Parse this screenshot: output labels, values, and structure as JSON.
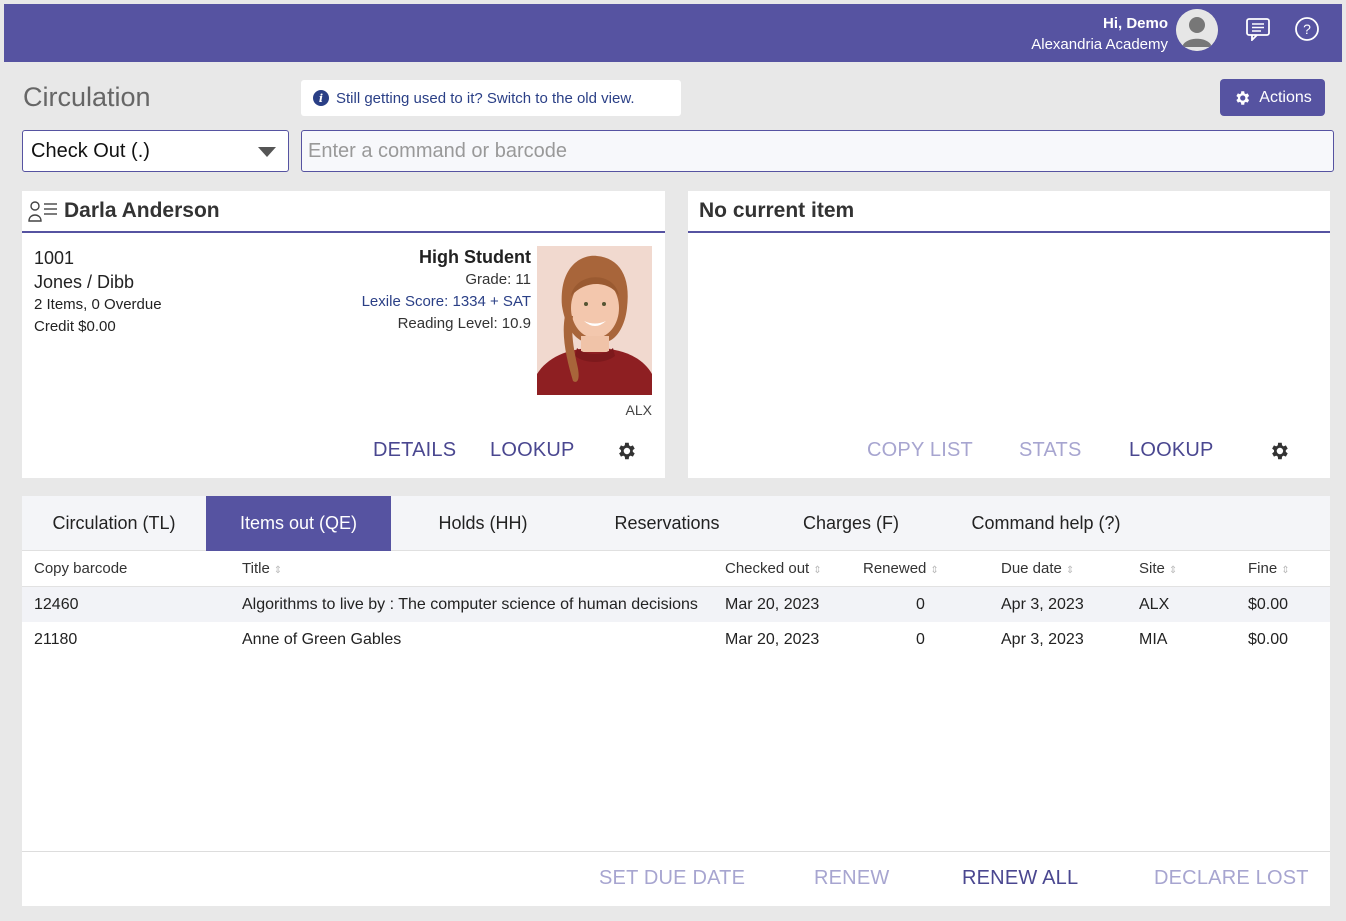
{
  "header": {
    "greeting": "Hi, Demo",
    "school": "Alexandria Academy",
    "icons": [
      "avatar",
      "messages-icon",
      "help-icon"
    ],
    "accent_color": "#5653a1"
  },
  "page": {
    "title": "Circulation",
    "old_view_text": "Still getting used to it? Switch to the old view.",
    "actions_label": "Actions"
  },
  "command": {
    "mode": "Check Out (.)",
    "placeholder": "Enter a command or barcode",
    "value": ""
  },
  "patron": {
    "name": "Darla Anderson",
    "barcode": "1001",
    "homeroom": "Jones / Dibb",
    "items_summary": "2 Items, 0 Overdue",
    "credit": "Credit $0.00",
    "type": "High Student",
    "grade": "Grade: 11",
    "lexile": "Lexile Score: 1334 + SAT",
    "reading_level": "Reading Level: 10.9",
    "site": "ALX",
    "links": {
      "details": "DETAILS",
      "lookup": "LOOKUP"
    }
  },
  "item_panel": {
    "title": "No current item",
    "links": {
      "copy_list": "COPY LIST",
      "stats": "STATS",
      "lookup": "LOOKUP"
    }
  },
  "tabs": [
    {
      "label": "Circulation (TL)",
      "active": false
    },
    {
      "label": "Items out (QE)",
      "active": true
    },
    {
      "label": "Holds (HH)",
      "active": false
    },
    {
      "label": "Reservations",
      "active": false
    },
    {
      "label": "Charges (F)",
      "active": false
    },
    {
      "label": "Command help (?)",
      "active": false
    }
  ],
  "table": {
    "columns": [
      "Copy barcode",
      "Title",
      "Checked out",
      "Renewed",
      "Due date",
      "Site",
      "Fine"
    ],
    "rows": [
      [
        "12460",
        "Algorithms to live by : The computer science of human decisions",
        "Mar 20, 2023",
        "0",
        "Apr 3, 2023",
        "ALX",
        "$0.00"
      ],
      [
        "21180",
        "Anne of Green Gables",
        "Mar 20, 2023",
        "0",
        "Apr 3, 2023",
        "MIA",
        "$0.00"
      ]
    ]
  },
  "footer_actions": {
    "set_due_date": "SET DUE DATE",
    "renew": "RENEW",
    "renew_all": "RENEW ALL",
    "declare_lost": "DECLARE LOST"
  }
}
